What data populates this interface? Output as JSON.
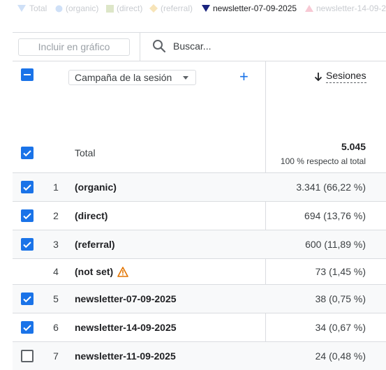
{
  "legend": [
    {
      "label": "Total",
      "marker": "drop",
      "active": false
    },
    {
      "label": "(organic)",
      "marker": "circle",
      "active": false
    },
    {
      "label": "(direct)",
      "marker": "square",
      "active": false
    },
    {
      "label": "(referral)",
      "marker": "diamond",
      "active": false
    },
    {
      "label": "newsletter-07-09-2025",
      "marker": "triangle-down",
      "active": true
    },
    {
      "label": "newsletter-14-09-2025",
      "marker": "triangle-up",
      "active": false
    }
  ],
  "toolbar": {
    "include_button": "Incluir en gráfico",
    "search_placeholder": "Buscar..."
  },
  "table": {
    "dimension": "Campaña de la sesión",
    "metric": "Sesiones",
    "total_label": "Total",
    "total_value": "5.045",
    "total_sub": "100 % respecto al total",
    "rows": [
      {
        "index": "1",
        "name": "(organic)",
        "value": "3.341 (66,22 %)",
        "checked": true
      },
      {
        "index": "2",
        "name": "(direct)",
        "value": "694 (13,76 %)",
        "checked": true
      },
      {
        "index": "3",
        "name": "(referral)",
        "value": "600 (11,89 %)",
        "checked": true
      },
      {
        "index": "4",
        "name": "(not set)",
        "value": "73 (1,45 %)",
        "checked": null,
        "warning": true
      },
      {
        "index": "5",
        "name": "newsletter-07-09-2025",
        "value": "38 (0,75 %)",
        "checked": true
      },
      {
        "index": "6",
        "name": "newsletter-14-09-2025",
        "value": "34 (0,67 %)",
        "checked": true
      },
      {
        "index": "7",
        "name": "newsletter-11-09-2025",
        "value": "24 (0,48 %)",
        "checked": false
      }
    ]
  },
  "colors": {
    "accent": "#1a73e8",
    "legend_active": "#1a237e",
    "warning": "#e37400"
  }
}
